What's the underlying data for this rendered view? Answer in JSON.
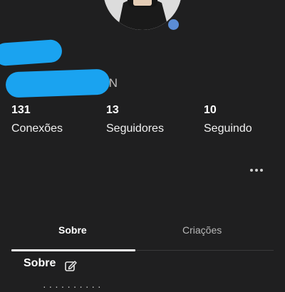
{
  "profile": {
    "username_visible_suffix": "N",
    "presence_color": "#5b8dd6",
    "redaction_color": "#1aa3f0"
  },
  "stats": [
    {
      "value": "131",
      "label": "Conexões"
    },
    {
      "value": "13",
      "label": "Seguidores"
    },
    {
      "value": "10",
      "label": "Seguindo"
    }
  ],
  "actions": {
    "more_icon": "more-horizontal-icon"
  },
  "tabs": [
    {
      "label": "Sobre",
      "active": true
    },
    {
      "label": "Criações",
      "active": false
    }
  ],
  "about_section": {
    "title": "Sobre",
    "edit_icon": "edit-pencil-icon",
    "cutoff_text": "· · · · · · · · · ·"
  }
}
